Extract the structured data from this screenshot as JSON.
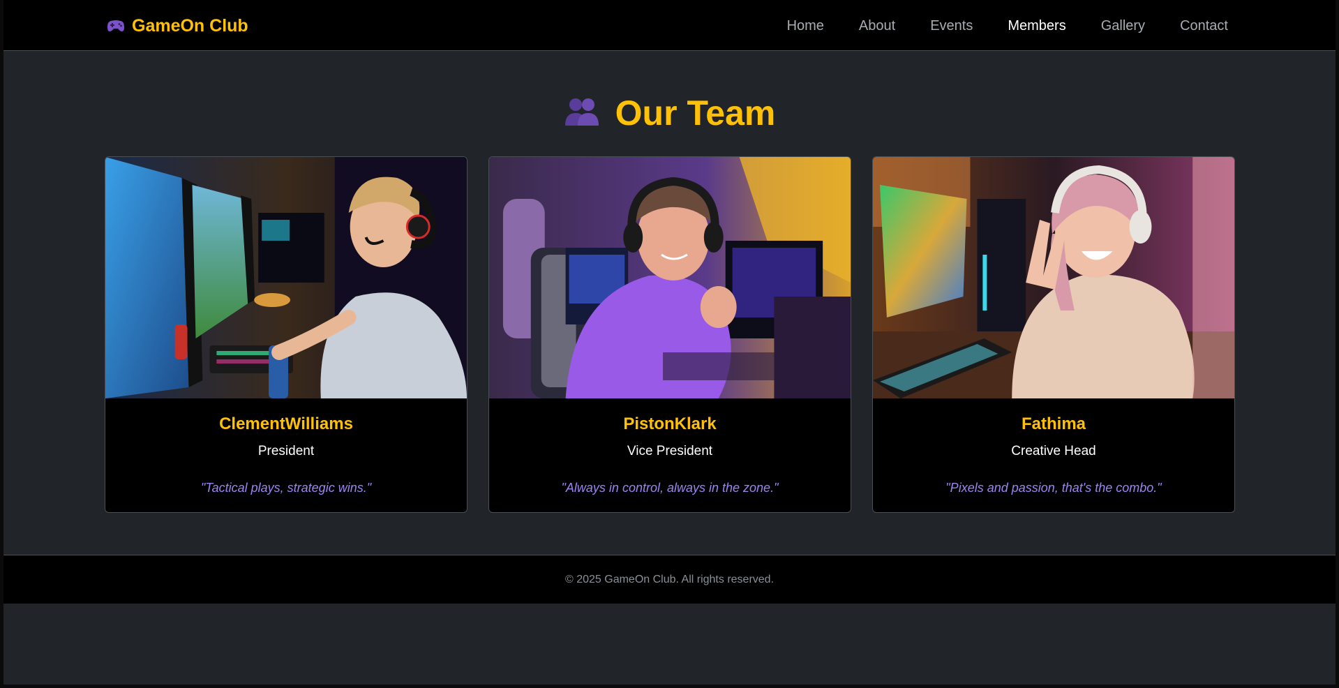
{
  "brand": {
    "icon": "gamepad-icon",
    "name": "GameOn Club",
    "color": "#ffc107"
  },
  "nav": {
    "items": [
      {
        "label": "Home",
        "active": false
      },
      {
        "label": "About",
        "active": false
      },
      {
        "label": "Events",
        "active": false
      },
      {
        "label": "Members",
        "active": true
      },
      {
        "label": "Gallery",
        "active": false
      },
      {
        "label": "Contact",
        "active": false
      }
    ]
  },
  "team": {
    "icon": "people-icon",
    "title": "Our Team"
  },
  "members": [
    {
      "name": "ClementWilliams",
      "role": "President",
      "quote": "\"Tactical plays, strategic wins.\"",
      "photo": "gamer-at-monitors-photo"
    },
    {
      "name": "PistonKlark",
      "role": "Vice President",
      "quote": "\"Always in control, always in the zone.\"",
      "photo": "gamer-with-headset-photo"
    },
    {
      "name": "Fathima",
      "role": "Creative Head",
      "quote": "\"Pixels and passion, that's the combo.\"",
      "photo": "gamer-selfie-photo"
    }
  ],
  "footer": {
    "text": "© 2025 GameOn Club. All rights reserved."
  },
  "colors": {
    "accent": "#ffc107",
    "quote": "#9d84f2",
    "background": "#212529",
    "navbar": "#000000"
  }
}
